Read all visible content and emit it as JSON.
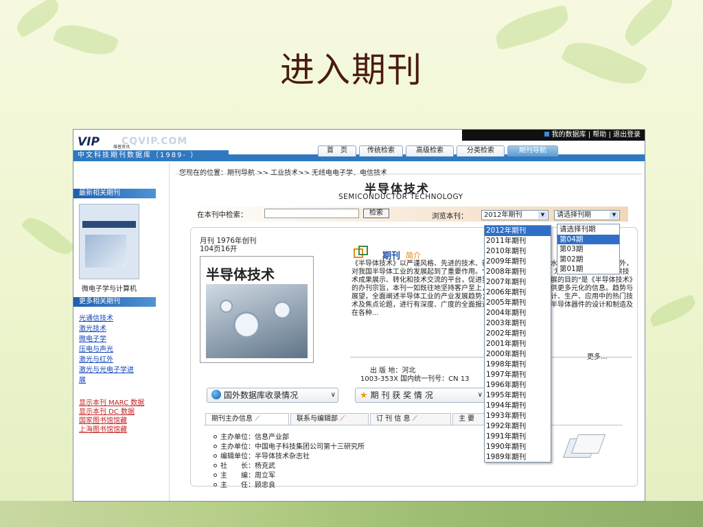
{
  "slide": {
    "title": "进入期刊"
  },
  "site": {
    "brand_strip": "中文科技期刊数据库（1989- ）",
    "logo_text": "VIP",
    "logo_sub": "维普资讯",
    "logo_domain": "CQVIP.COM"
  },
  "userbar": {
    "my_db": "我的数据库",
    "sep1": "|",
    "help": "帮助",
    "sep2": "|",
    "logout": "退出登录"
  },
  "nav": {
    "items": [
      {
        "label": "首　页"
      },
      {
        "label": "传统检索"
      },
      {
        "label": "高级检索"
      },
      {
        "label": "分类检索"
      },
      {
        "label": "期刊导航"
      }
    ]
  },
  "breadcrumb": "您现在的位置：期刊导航 >> 工业技术>> 无线电电子学、电信技术",
  "journal": {
    "title_cn": "半导体技术",
    "title_en": "SEMICONDUCTOR TECHNOLOGY",
    "freq": "月刊  1976年创刊",
    "pages": "104页16开",
    "cover_title": "半导体技术",
    "intro_label": "期刊",
    "intro_sub": "简介",
    "intro_text": "《半导体技术》以严谨风格、先进的技术、新颖的内容和高质量的水平的评期望，享誉中外，对我国半导体工业的发展起到了重要作用。\"向读者提供更好资讯，为企业开拓市场，提供技术成果展示、转化和技术交流的平台，促进我国半导体技术不断发展的目的\"是《半导体技术》的办刊宗旨，本刊一如既往地坚持客户至上，服务第一，为读者提供更多元化的信息。趋势与展望，全面阐述半导体工业的产业发展趋势；专题报道，每期就设计、生产、应用中的热门技术及焦点论题，进行有深度、广度的全面报道，集成电路与应用，半导体器件的设计和制造及在各种...",
    "more": "更多...",
    "publish_place": "出 版 地：河北",
    "issn": "1003-353X  国内统一刊号：CN 13"
  },
  "sidebar": {
    "latest_head": "最新相关期刊",
    "latest_caption": "微电子学与计算机",
    "more_head": "更多相关期刊",
    "related": [
      "光通信技术",
      "激光技术",
      "微电子学",
      "压电与声光",
      "激光与红外",
      "激光与光电子学进",
      "展"
    ],
    "marc_links": [
      "显示本刊 MARC 数据",
      "显示本刊 DC 数据",
      "国家图书馆馆藏",
      "上海图书馆馆藏"
    ]
  },
  "search": {
    "label": "在本刊中检索：",
    "value": "",
    "button": "检索",
    "browse_label": "浏览本刊：",
    "year_selected": "2012年期刊",
    "issue_selected": "请选择刊期"
  },
  "year_list": [
    "2012年期刊",
    "2011年期刊",
    "2010年期刊",
    "2009年期刊",
    "2008年期刊",
    "2007年期刊",
    "2006年期刊",
    "2005年期刊",
    "2004年期刊",
    "2003年期刊",
    "2002年期刊",
    "2001年期刊",
    "2000年期刊",
    "1998年期刊",
    "1997年期刊",
    "1996年期刊",
    "1995年期刊",
    "1994年期刊",
    "1993年期刊",
    "1992年期刊",
    "1991年期刊",
    "1990年期刊",
    "1989年期刊"
  ],
  "issue_list": [
    "请选择刊期",
    "第04期",
    "第03期",
    "第02期",
    "第01期"
  ],
  "buttons": {
    "foreign_db": "国外数据库收录情况",
    "awards": "期 刊 获 奖 情 况"
  },
  "tabs": [
    {
      "label": "期刊主办信息"
    },
    {
      "label": "联系与编辑部"
    },
    {
      "label": "订 刊 信 息"
    },
    {
      "label": "主 要"
    }
  ],
  "info": [
    "主办单位：信息产业部",
    "主办单位：中国电子科技集团公司第十三研究所",
    "编辑单位：半导体技术杂志社",
    "社　　长：杨克武",
    "主　　编：周立军",
    "主　　任：顾忠良"
  ]
}
